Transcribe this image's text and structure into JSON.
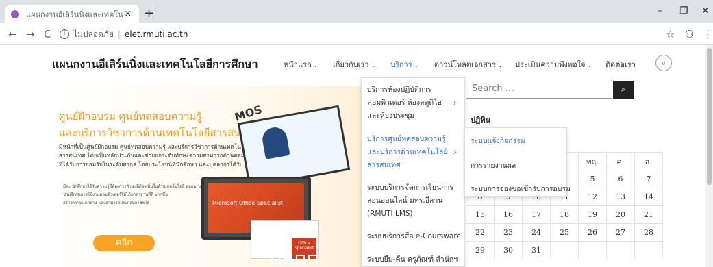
{
  "browser": {
    "tab_title": "แผนกงานอีเลิร์นนิ่งและเทคโนโลยีการศึกษ",
    "tab_close": "×",
    "new_tab": "+",
    "minimize": "–",
    "maximize": "❐",
    "close": "✕",
    "back": "←",
    "forward": "→",
    "reload": "C",
    "insecure_label": "ไม่ปลอดภัย",
    "separator": "|",
    "url": "elet.rmuti.ac.th",
    "star": "☆",
    "account": "⚇",
    "more": "⋮"
  },
  "site": {
    "title": "แผนกงานอีเลิร์นนิ่งและเทคโนโลยีการศึกษา",
    "menu": [
      {
        "label": "หน้าแรก",
        "chevron": "⌄"
      },
      {
        "label": "เกี่ยวกับเรา",
        "chevron": "⌄"
      },
      {
        "label": "บริการ",
        "chevron": "⌄"
      },
      {
        "label": "ดาวน์โหลดเอกสาร",
        "chevron": "⌄"
      },
      {
        "label": "ประเมินความพึงพอใจ",
        "chevron": "⌄"
      },
      {
        "label": "ติดต่อเรา",
        "chevron": ""
      }
    ],
    "search_icon": "search-icon"
  },
  "banner": {
    "head1": "ศูนย์ฝึกอบรม ศูนย์ทดสอบความรู้",
    "head2": "และบริการวิชาการด้านเทคโนโลยีสารสนเทศ",
    "desc": "มีหน้าที่เป็นศูนย์ฝึกอบรม ศูนย์ทดสอบความรู้ และบริการวิชาการด้านเทคโนโลยีสารสนเทศ โดยเป็นหลักประกันและช่วยยกระดับทักษะความสามารถด้านคอมพิวเตอร์ที่ได้รับการยอมรับในระดับสากล โดยประโยชน์ที่นักศึกษา และบุคลากรได้รับ คือ",
    "bullets": [
      "มีคะ นักศึกษาได้รับความรู้ที่ต้องการทักษะที่ต้องเพิ่มในด้านเทคโนโลยี ตลอดเวลา",
      "ช่วยฝึกฝนการใช้งานคอมพิวเตอร์ให้ได้มาตรฐานที่ดี มากขึ้น",
      "สร้างความแตกต่าง และสามารถประกอบอาชีพได้"
    ],
    "cta": "คลิก",
    "mos": "MOS",
    "laptop_text": "Microsoft Office Specialist",
    "badge_text": "Office Specialist"
  },
  "sidebar": {
    "search_placeholder": "Search ...",
    "search_button": "🔍",
    "calendar_heading": "ปฏิทิน",
    "calendar_headers": [
      "",
      "",
      "",
      "",
      "พฤ.",
      "ศ.",
      "ส."
    ],
    "calendar_rows": [
      [
        "",
        "",
        "",
        "",
        "5",
        "6",
        "7"
      ],
      [
        "8",
        "9",
        "10",
        "11",
        "12",
        "13",
        "14"
      ],
      [
        "15",
        "16",
        "17",
        "18",
        "19",
        "20",
        "21"
      ],
      [
        "22",
        "23",
        "24",
        "25",
        "26",
        "27",
        "28"
      ],
      [
        "29",
        "30",
        "31",
        "",
        "",
        "",
        ""
      ]
    ]
  },
  "dropdown": {
    "items": [
      {
        "label": "บริการห้องปฏิบัติการคอมพิวเตอร์ ห้องสตูดิโอและห้องประชุม",
        "arrow": "›"
      },
      {
        "label": "บริการศูนย์ทดสอบความรู้และบริการด้านเทคโนโลยีสารสนเทศ",
        "arrow": "›"
      },
      {
        "label": "ระบบบริการจัดการเรียนการสอนออนไลน์ มทร.อีสาน (RMUTI LMS)",
        "arrow": ""
      },
      {
        "label": "ระบบบริการสื่อ e-Coursware",
        "arrow": ""
      },
      {
        "label": "ระบบยืม-คืน ครุภัณฑ์ สำนักฯ",
        "arrow": ""
      }
    ],
    "sub_items": [
      "ระบบแจ้งกิจกรรม",
      "การรายงานผล",
      "ระบบการจองขอเข้ารับการอบรม"
    ]
  }
}
